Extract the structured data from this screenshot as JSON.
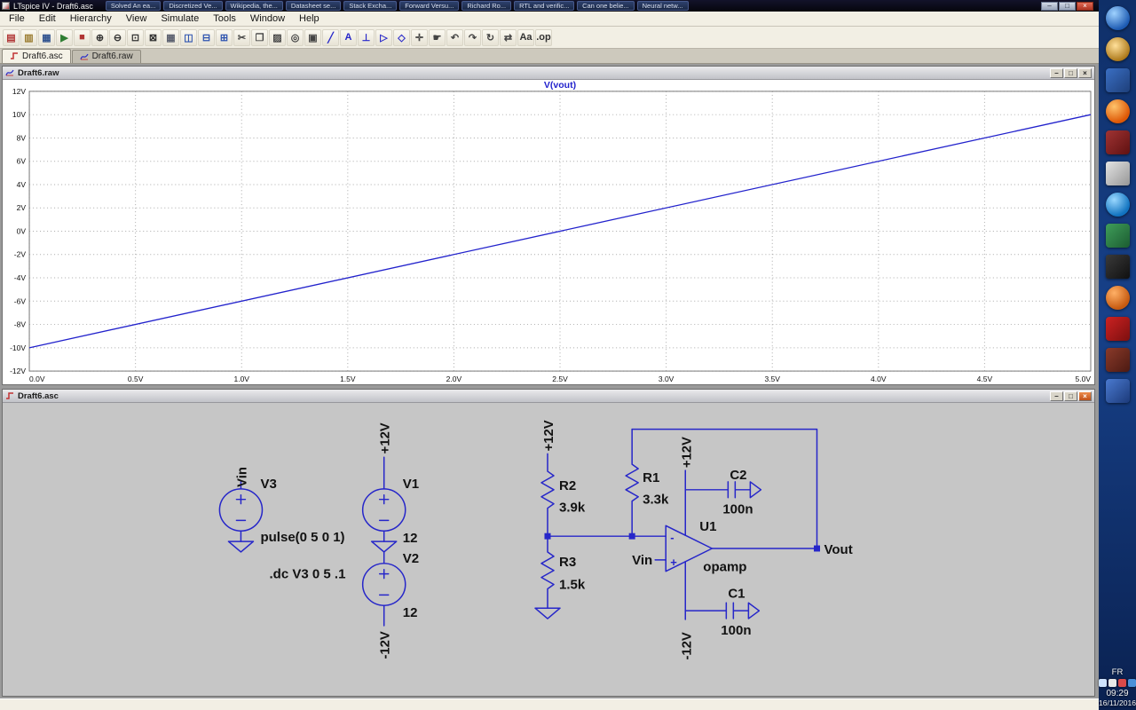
{
  "window": {
    "title": "LTspice IV - Draft6.asc",
    "buttons": {
      "minimize": "–",
      "maximize": "□",
      "close": "×"
    }
  },
  "taskbar": {
    "items": [
      {
        "label": "Solved An ea..."
      },
      {
        "label": "Discretized Ve..."
      },
      {
        "label": "Wikipedia, the..."
      },
      {
        "label": "Datasheet se..."
      },
      {
        "label": "Stack Excha..."
      },
      {
        "label": "Forward Versu..."
      },
      {
        "label": "Richard Ro..."
      },
      {
        "label": "RTL and verific..."
      },
      {
        "label": "Can one belie..."
      },
      {
        "label": "Neural netw..."
      }
    ]
  },
  "menu": {
    "items": [
      {
        "name": "menu-file",
        "label": "File"
      },
      {
        "name": "menu-edit",
        "label": "Edit"
      },
      {
        "name": "menu-hierarchy",
        "label": "Hierarchy"
      },
      {
        "name": "menu-view",
        "label": "View"
      },
      {
        "name": "menu-simulate",
        "label": "Simulate"
      },
      {
        "name": "menu-tools",
        "label": "Tools"
      },
      {
        "name": "menu-window",
        "label": "Window"
      },
      {
        "name": "menu-help",
        "label": "Help"
      }
    ]
  },
  "toolbar": {
    "icons": [
      {
        "name": "new-schematic-icon",
        "glyph": "▤",
        "color": "#b03434"
      },
      {
        "name": "open-file-icon",
        "glyph": "▥",
        "color": "#9a7b2f"
      },
      {
        "name": "save-icon",
        "glyph": "▦",
        "color": "#31538f"
      },
      {
        "name": "run-icon",
        "glyph": "▶",
        "color": "#2e7d32"
      },
      {
        "name": "halt-icon",
        "glyph": "■",
        "color": "#b03434"
      },
      {
        "name": "zoom-in-icon",
        "glyph": "⊕",
        "color": "#333333"
      },
      {
        "name": "zoom-out-icon",
        "glyph": "⊖",
        "color": "#333333"
      },
      {
        "name": "zoom-area-icon",
        "glyph": "⊡",
        "color": "#333333"
      },
      {
        "name": "zoom-fit-icon",
        "glyph": "⊠",
        "color": "#333333"
      },
      {
        "name": "grid-icon",
        "glyph": "▦",
        "color": "#5a5f6e"
      },
      {
        "name": "tile-vertical-icon",
        "glyph": "◫",
        "color": "#2f55b0"
      },
      {
        "name": "tile-horizontal-icon",
        "glyph": "⊟",
        "color": "#2f55b0"
      },
      {
        "name": "cascade-windows-icon",
        "glyph": "⊞",
        "color": "#2f55b0"
      },
      {
        "name": "cut-icon",
        "glyph": "✂",
        "color": "#444444"
      },
      {
        "name": "copy-icon",
        "glyph": "❐",
        "color": "#444444"
      },
      {
        "name": "paste-icon",
        "glyph": "▨",
        "color": "#444444"
      },
      {
        "name": "find-icon",
        "glyph": "◎",
        "color": "#444444"
      },
      {
        "name": "print-icon",
        "glyph": "▣",
        "color": "#444444"
      },
      {
        "name": "wire-icon",
        "glyph": "╱",
        "color": "#2626c9"
      },
      {
        "name": "label-net-icon",
        "glyph": "A",
        "color": "#2626c9"
      },
      {
        "name": "ground-icon",
        "glyph": "⊥",
        "color": "#2626c9"
      },
      {
        "name": "diode-icon",
        "glyph": "▷",
        "color": "#2626c9"
      },
      {
        "name": "component-icon",
        "glyph": "◇",
        "color": "#2626c9"
      },
      {
        "name": "move-icon",
        "glyph": "✛",
        "color": "#444444"
      },
      {
        "name": "drag-icon",
        "glyph": "☛",
        "color": "#444444"
      },
      {
        "name": "undo-icon",
        "glyph": "↶",
        "color": "#444444"
      },
      {
        "name": "redo-icon",
        "glyph": "↷",
        "color": "#444444"
      },
      {
        "name": "rotate-icon",
        "glyph": "↻",
        "color": "#444444"
      },
      {
        "name": "mirror-icon",
        "glyph": "⇄",
        "color": "#444444"
      },
      {
        "name": "text-icon",
        "glyph": "Aa",
        "color": "#333333"
      },
      {
        "name": "spice-directive-icon",
        "glyph": ".op",
        "color": "#333333"
      }
    ]
  },
  "tabs": {
    "asc": "Draft6.asc",
    "raw": "Draft6.raw"
  },
  "plot_window": {
    "title": "Draft6.raw"
  },
  "schematic_window": {
    "title": "Draft6.asc"
  },
  "chart_data": {
    "type": "line",
    "title": "V(vout)",
    "x": [
      0,
      5
    ],
    "series": [
      {
        "name": "V(vout)",
        "values": [
          -10,
          10
        ]
      }
    ],
    "xlim": [
      0,
      5
    ],
    "ylim": [
      -12,
      12
    ],
    "grid": true,
    "legend": "none",
    "x_ticks": [
      {
        "v": 0,
        "label": "0.0V"
      },
      {
        "v": 0.5,
        "label": "0.5V"
      },
      {
        "v": 1,
        "label": "1.0V"
      },
      {
        "v": 1.5,
        "label": "1.5V"
      },
      {
        "v": 2,
        "label": "2.0V"
      },
      {
        "v": 2.5,
        "label": "2.5V"
      },
      {
        "v": 3,
        "label": "3.0V"
      },
      {
        "v": 3.5,
        "label": "3.5V"
      },
      {
        "v": 4,
        "label": "4.0V"
      },
      {
        "v": 4.5,
        "label": "4.5V"
      },
      {
        "v": 5,
        "label": "5.0V"
      }
    ],
    "y_ticks": [
      {
        "v": 12,
        "label": "12V"
      },
      {
        "v": 10,
        "label": "10V"
      },
      {
        "v": 8,
        "label": "8V"
      },
      {
        "v": 6,
        "label": "6V"
      },
      {
        "v": 4,
        "label": "4V"
      },
      {
        "v": 2,
        "label": "2V"
      },
      {
        "v": 0,
        "label": "0V"
      },
      {
        "v": -2,
        "label": "-2V"
      },
      {
        "v": -4,
        "label": "-4V"
      },
      {
        "v": -6,
        "label": "-6V"
      },
      {
        "v": -8,
        "label": "-8V"
      },
      {
        "v": -10,
        "label": "-10V"
      },
      {
        "v": -12,
        "label": "-12V"
      }
    ]
  },
  "schematic": {
    "v3": {
      "designator": "V3",
      "value": "pulse(0 5 0 1)",
      "net": "Vin"
    },
    "v1": {
      "designator": "V1",
      "value": "12",
      "net": "+12V"
    },
    "v2": {
      "designator": "V2",
      "value": "12",
      "net": "-12V"
    },
    "r1": {
      "designator": "R1",
      "value": "3.3k"
    },
    "r2": {
      "designator": "R2",
      "value": "3.9k",
      "net": "+12V"
    },
    "r3": {
      "designator": "R3",
      "value": "1.5k"
    },
    "c1": {
      "designator": "C1",
      "value": "100n"
    },
    "c2": {
      "designator": "C2",
      "value": "100n"
    },
    "u1": {
      "designator": "U1",
      "value": "opamp",
      "pos_rail": "+12V",
      "neg_rail": "-12V",
      "minus": "-",
      "plus": "+",
      "vin": "Vin"
    },
    "vout": "Vout",
    "directive": ".dc V3 0 5 .1"
  },
  "statusbar": {
    "text": ""
  },
  "desktop": {
    "icons": [
      {
        "name": "desktop-icon-blue-globe",
        "bg": "radial-gradient(circle at 35% 30%, #9fd2ff, #1c5ab2 72%)",
        "br": "50%"
      },
      {
        "name": "desktop-icon-gold-coil",
        "bg": "radial-gradient(circle at 40% 35%, #ffe09a, #a97414 75%)",
        "br": "50%"
      },
      {
        "name": "desktop-icon-blue-document",
        "bg": "linear-gradient(135deg,#3a6fc4,#1e3f7a)",
        "br": "4px"
      },
      {
        "name": "desktop-icon-firefox",
        "bg": "radial-gradient(circle at 35% 30%, #ffc36b, #dd5705 70%)",
        "br": "50%"
      },
      {
        "name": "desktop-icon-red-media",
        "bg": "linear-gradient(135deg,#a03333,#5f1111)",
        "br": "4px"
      },
      {
        "name": "desktop-icon-ltspice",
        "bg": "linear-gradient(135deg,#e4e4e4,#969696)",
        "br": "3px"
      },
      {
        "name": "desktop-icon-ie-globe",
        "bg": "radial-gradient(circle at 35% 30%, #9ad8ff, #1173c0 70%)",
        "br": "50%"
      },
      {
        "name": "desktop-icon-green-app",
        "bg": "linear-gradient(135deg,#3f9e5a,#1c5c31)",
        "br": "4px"
      },
      {
        "name": "desktop-icon-console",
        "bg": "linear-gradient(135deg,#3a3a3a,#101010)",
        "br": "3px"
      },
      {
        "name": "desktop-icon-orange-app",
        "bg": "radial-gradient(circle at 35% 30%, #ffb066, #c65a10 70%)",
        "br": "50%"
      },
      {
        "name": "desktop-icon-acrobat",
        "bg": "linear-gradient(135deg,#cc2222,#7c0f0f)",
        "br": "4px"
      },
      {
        "name": "desktop-icon-maroon-app",
        "bg": "linear-gradient(135deg,#8a3a2a,#4c1a12)",
        "br": "4px"
      },
      {
        "name": "desktop-icon-blue-app",
        "bg": "linear-gradient(135deg,#4a7ad0,#1c3a7a)",
        "br": "4px"
      }
    ],
    "tray": {
      "language": "FR",
      "time": "09:29",
      "date": "16/11/2016",
      "icons": [
        {
          "name": "tray-network-icon",
          "bg": "#cfe3ff"
        },
        {
          "name": "tray-volume-icon",
          "bg": "#e8e8e8"
        },
        {
          "name": "tray-shield-icon",
          "bg": "#d94a4a"
        },
        {
          "name": "tray-app-icon",
          "bg": "#4a90d9"
        }
      ]
    }
  }
}
